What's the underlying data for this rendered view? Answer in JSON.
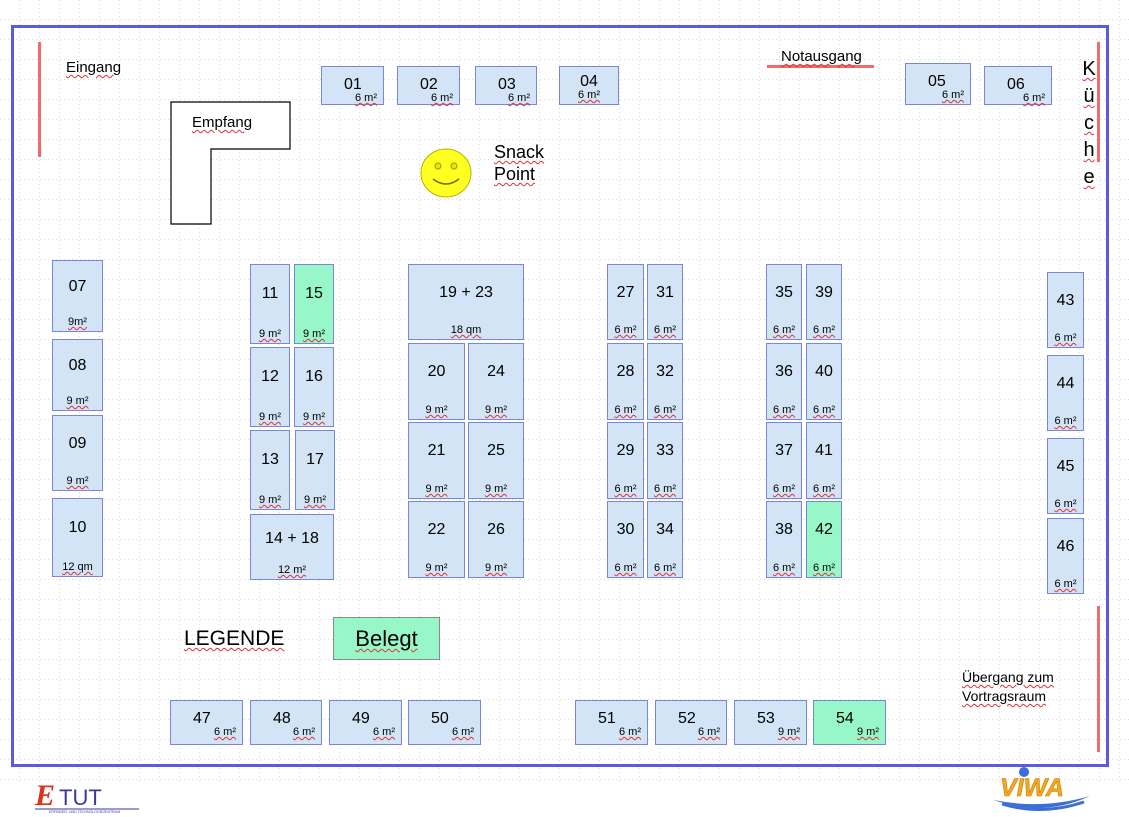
{
  "labels": {
    "entrance": "Eingang",
    "reception": "Empfang",
    "emergency_exit": "Notausgang",
    "snack_line1": "Snack",
    "snack_line2": "Point",
    "kitchen": [
      "K",
      "ü",
      "c",
      "h",
      "e"
    ],
    "passage_line1": "Übergang zum",
    "passage_line2": "Vortragsraum"
  },
  "legend": {
    "title": "LEGENDE",
    "booked_label": "Belegt",
    "booked_color": "#98f7c8"
  },
  "colors": {
    "stand_free": "#d2e4f5",
    "stand_booked": "#98f7c8",
    "frame": "#5a5ae6",
    "marker": "#f26b6b"
  },
  "stands": [
    {
      "num": "01",
      "size": "6 m²",
      "booked": false
    },
    {
      "num": "02",
      "size": "6 m²",
      "booked": false
    },
    {
      "num": "03",
      "size": "6 m²",
      "booked": false
    },
    {
      "num": "04",
      "size": "6 m²",
      "booked": false
    },
    {
      "num": "05",
      "size": "6 m²",
      "booked": false
    },
    {
      "num": "06",
      "size": "6 m²",
      "booked": false
    },
    {
      "num": "07",
      "size": "9m²",
      "booked": false
    },
    {
      "num": "08",
      "size": "9 m²",
      "booked": false
    },
    {
      "num": "09",
      "size": "9 m²",
      "booked": false
    },
    {
      "num": "10",
      "size": "12 qm",
      "booked": false
    },
    {
      "num": "11",
      "size": "9 m²",
      "booked": false
    },
    {
      "num": "15",
      "size": "9 m²",
      "booked": true
    },
    {
      "num": "12",
      "size": "9 m²",
      "booked": false
    },
    {
      "num": "16",
      "size": "9 m²",
      "booked": false
    },
    {
      "num": "13",
      "size": "9 m²",
      "booked": false
    },
    {
      "num": "17",
      "size": "9 m²",
      "booked": false
    },
    {
      "num": "14 + 18",
      "size": "12 m²",
      "booked": false
    },
    {
      "num": "19  +  23",
      "size": "18 qm",
      "booked": false
    },
    {
      "num": "20",
      "size": "9 m²",
      "booked": false
    },
    {
      "num": "24",
      "size": "9 m²",
      "booked": false
    },
    {
      "num": "21",
      "size": "9 m²",
      "booked": false
    },
    {
      "num": "25",
      "size": "9 m²",
      "booked": false
    },
    {
      "num": "22",
      "size": "9 m²",
      "booked": false
    },
    {
      "num": "26",
      "size": "9 m²",
      "booked": false
    },
    {
      "num": "27",
      "size": "6 m²",
      "booked": false
    },
    {
      "num": "31",
      "size": "6 m²",
      "booked": false
    },
    {
      "num": "28",
      "size": "6 m²",
      "booked": false
    },
    {
      "num": "32",
      "size": "6 m²",
      "booked": false
    },
    {
      "num": "29",
      "size": "6 m²",
      "booked": false
    },
    {
      "num": "33",
      "size": "6 m²",
      "booked": false
    },
    {
      "num": "30",
      "size": "6 m²",
      "booked": false
    },
    {
      "num": "34",
      "size": "6 m²",
      "booked": false
    },
    {
      "num": "35",
      "size": "6 m²",
      "booked": false
    },
    {
      "num": "39",
      "size": "6 m²",
      "booked": false
    },
    {
      "num": "36",
      "size": "6 m²",
      "booked": false
    },
    {
      "num": "40",
      "size": "6 m²",
      "booked": false
    },
    {
      "num": "37",
      "size": "6 m²",
      "booked": false
    },
    {
      "num": "41",
      "size": "6 m²",
      "booked": false
    },
    {
      "num": "38",
      "size": "6 m²",
      "booked": false
    },
    {
      "num": "42",
      "size": "6 m²",
      "booked": true
    },
    {
      "num": "43",
      "size": "6 m²",
      "booked": false
    },
    {
      "num": "44",
      "size": "6 m²",
      "booked": false
    },
    {
      "num": "45",
      "size": "6 m²",
      "booked": false
    },
    {
      "num": "46",
      "size": "6 m²",
      "booked": false
    },
    {
      "num": "47",
      "size": "6 m²",
      "booked": false
    },
    {
      "num": "48",
      "size": "6 m²",
      "booked": false
    },
    {
      "num": "49",
      "size": "6 m²",
      "booked": false
    },
    {
      "num": "50",
      "size": "6 m²",
      "booked": false
    },
    {
      "num": "51",
      "size": "6 m²",
      "booked": false
    },
    {
      "num": "52",
      "size": "6 m²",
      "booked": false
    },
    {
      "num": "53",
      "size": "9 m²",
      "booked": false
    },
    {
      "num": "54",
      "size": "9 m²",
      "booked": true
    }
  ],
  "logos": {
    "left": "ETUT",
    "left_sub": "ERFINDER- UND TECHNOLOGIEZENTRUM",
    "right": "VIWA"
  }
}
